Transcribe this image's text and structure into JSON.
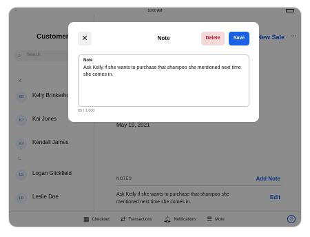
{
  "status_bar": {
    "time": "10:00 AM"
  },
  "sidebar": {
    "title": "Customers",
    "search_placeholder": "Search",
    "sections": [
      {
        "letter": "K"
      },
      {
        "letter": "L"
      }
    ],
    "people": [
      {
        "initials": "KB",
        "name": "Kelly Brinkerhoff",
        "sub": ""
      },
      {
        "initials": "KJ",
        "name": "Kai Jones",
        "sub": ""
      },
      {
        "initials": "KJ",
        "name": "Kendall James",
        "sub": ""
      },
      {
        "initials": "LG",
        "name": "Logan Glickfield",
        "sub": ""
      },
      {
        "initials": "LD",
        "name": "Leslie Doe",
        "sub": ""
      }
    ]
  },
  "main": {
    "new_sale": "New Sale",
    "more": "⋯",
    "date": "May 19, 2021",
    "notes_header": "NOTES",
    "add_note": "Add Note",
    "note_text": "Ask Kelly if she wants to purchase that shampoo she mentioned next time she comes in.",
    "edit": "Edit"
  },
  "tabbar": {
    "tabs": [
      {
        "label": "Checkout",
        "icon": "grid-icon"
      },
      {
        "label": "Transactions",
        "icon": "arrows-icon"
      },
      {
        "label": "Notifications",
        "icon": "bell-icon"
      },
      {
        "label": "More",
        "icon": "menu-icon"
      }
    ]
  },
  "modal": {
    "title": "Note",
    "close_icon": "close-icon",
    "delete_label": "Delete",
    "save_label": "Save",
    "field_label": "Note",
    "field_value": "Ask Kelly if she wants to purchase that shampoo she mentioned next time she comes in.",
    "counter": "85 / 1,000"
  },
  "colors": {
    "accent": "#1a61e6",
    "destructive": "#c8102e",
    "destructive_bg": "#f5dadb",
    "overlay": "rgba(0,0,0,0.45)"
  }
}
